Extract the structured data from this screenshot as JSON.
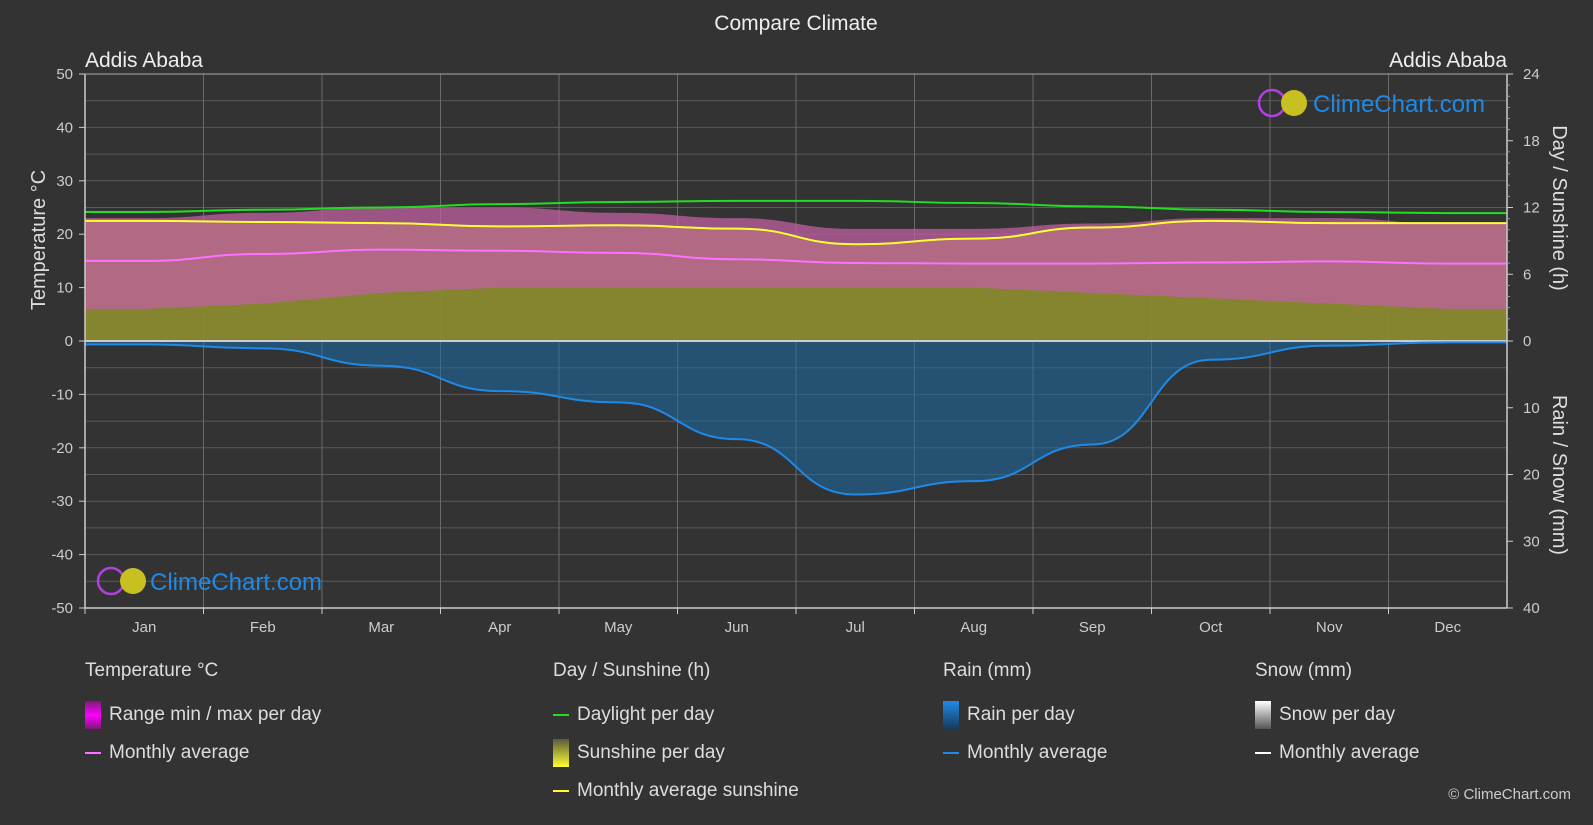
{
  "title": "Compare Climate",
  "location_left": "Addis Ababa",
  "location_right": "Addis Ababa",
  "watermark": "ClimeChart.com",
  "copyright": "© ClimeChart.com",
  "colors": {
    "background": "#333333",
    "grid": "#5a5a5a",
    "temp_range": "#c060a0",
    "temp_avg": "#ff70ff",
    "daylight": "#22dd22",
    "sunshine_fill": "#8a8a30",
    "sunshine_avg": "#ffff33",
    "rain_fill": "#1a6aa8",
    "rain_avg": "#1e8ae6",
    "snow_avg": "#ffffff",
    "watermark_text": "#1e8ae6"
  },
  "chart_data": {
    "type": "area",
    "title": "Compare Climate",
    "categories": [
      "Jan",
      "Feb",
      "Mar",
      "Apr",
      "May",
      "Jun",
      "Jul",
      "Aug",
      "Sep",
      "Oct",
      "Nov",
      "Dec"
    ],
    "axes": {
      "left": {
        "label": "Temperature °C",
        "range": [
          -50,
          50
        ],
        "ticks": [
          "50",
          "40",
          "30",
          "20",
          "10",
          "0",
          "-10",
          "-20",
          "-30",
          "-40",
          "-50"
        ]
      },
      "right_top": {
        "label": "Day / Sunshine (h)",
        "range": [
          0,
          24
        ],
        "ticks": [
          "24",
          "18",
          "12",
          "6",
          "0"
        ]
      },
      "right_bottom": {
        "label": "Rain / Snow (mm)",
        "range": [
          0,
          40
        ],
        "ticks": [
          "0",
          "10",
          "20",
          "30",
          "40"
        ]
      }
    },
    "grid": true,
    "series": [
      {
        "name": "Temperature monthly average (°C)",
        "axis": "left",
        "values": [
          15.0,
          16.3,
          17.1,
          16.9,
          16.5,
          15.3,
          14.6,
          14.5,
          14.5,
          14.7,
          14.9,
          14.5
        ]
      },
      {
        "name": "Temperature range min (°C)",
        "axis": "left",
        "values": [
          6,
          7,
          9,
          10,
          10,
          10,
          10,
          10,
          9,
          8,
          7,
          6
        ]
      },
      {
        "name": "Temperature range max (°C)",
        "axis": "left",
        "values": [
          23,
          24,
          25,
          25,
          24,
          23,
          21,
          21,
          22,
          23,
          23,
          22
        ]
      },
      {
        "name": "Daylight per day (h)",
        "axis": "right_top",
        "values": [
          11.6,
          11.8,
          12.0,
          12.3,
          12.5,
          12.6,
          12.6,
          12.4,
          12.1,
          11.8,
          11.6,
          11.5
        ]
      },
      {
        "name": "Monthly average sunshine (h)",
        "axis": "right_top",
        "values": [
          10.8,
          10.7,
          10.6,
          10.3,
          10.4,
          10.1,
          8.7,
          9.2,
          10.2,
          10.8,
          10.6,
          10.6
        ]
      },
      {
        "name": "Rain monthly average (mm)",
        "axis": "right_bottom",
        "values": [
          0.5,
          1.1,
          3.7,
          7.5,
          9.2,
          14.7,
          23.0,
          21.0,
          15.5,
          2.8,
          0.7,
          0.2
        ]
      },
      {
        "name": "Snow monthly average (mm)",
        "axis": "right_bottom",
        "values": [
          0,
          0,
          0,
          0,
          0,
          0,
          0,
          0,
          0,
          0,
          0,
          0
        ]
      }
    ]
  },
  "legend": {
    "temperature": {
      "header": "Temperature °C",
      "items": [
        "Range min / max per day",
        "Monthly average"
      ]
    },
    "sunshine": {
      "header": "Day / Sunshine (h)",
      "items": [
        "Daylight per day",
        "Sunshine per day",
        "Monthly average sunshine"
      ]
    },
    "rain": {
      "header": "Rain (mm)",
      "items": [
        "Rain per day",
        "Monthly average"
      ]
    },
    "snow": {
      "header": "Snow (mm)",
      "items": [
        "Snow per day",
        "Monthly average"
      ]
    }
  }
}
